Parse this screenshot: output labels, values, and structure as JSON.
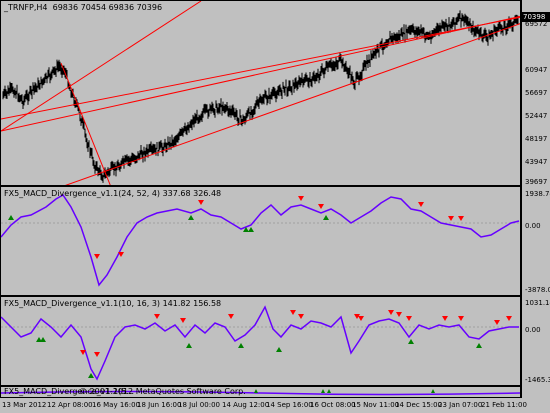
{
  "chart": {
    "symbol_label": "_TRNFP,H4",
    "ohlc_label": "69836 70454 69836 70396",
    "current_price": "70398",
    "price_ticks": [
      "69572",
      "60947",
      "56697",
      "52447",
      "48197",
      "43947",
      "39697"
    ],
    "time_ticks": [
      "13 Mar 2012",
      "12 Apr 08:00",
      "16 May 16:00",
      "18 Jun 16:00",
      "18 Jul 00:00",
      "14 Aug 12:00",
      "14 Sep 16:00",
      "16 Oct 08:00",
      "15 Nov 11:00",
      "14 Dec 15:00",
      "23 Jan 07:00",
      "21 Feb 11:00"
    ],
    "copyright_text": "© 2001-2012 MetaQuotes Software Corp.",
    "colors": {
      "price_line": "#000000",
      "trendline": "#ff0000",
      "macd": "#6600ff",
      "arrow_up": "#008000",
      "arrow_down": "#ff0000"
    }
  },
  "indicator1": {
    "title": "FX5_MACD_Divergence_v1.1(24, 52, 4) 337.68 326.48",
    "top_tick": "1938.74",
    "zero_tick": "0.00",
    "bottom_tick": "-3878.06"
  },
  "indicator2": {
    "title": "FX5_MACD_Divergence_v1.1(10, 16, 3) 141.82 156.58",
    "top_tick": "1031.14",
    "zero_tick": "0.00",
    "bottom_tick": "-1465.33"
  },
  "indicator3": {
    "title": "FX5_MACD_Divergence_v1.1(5..."
  }
}
